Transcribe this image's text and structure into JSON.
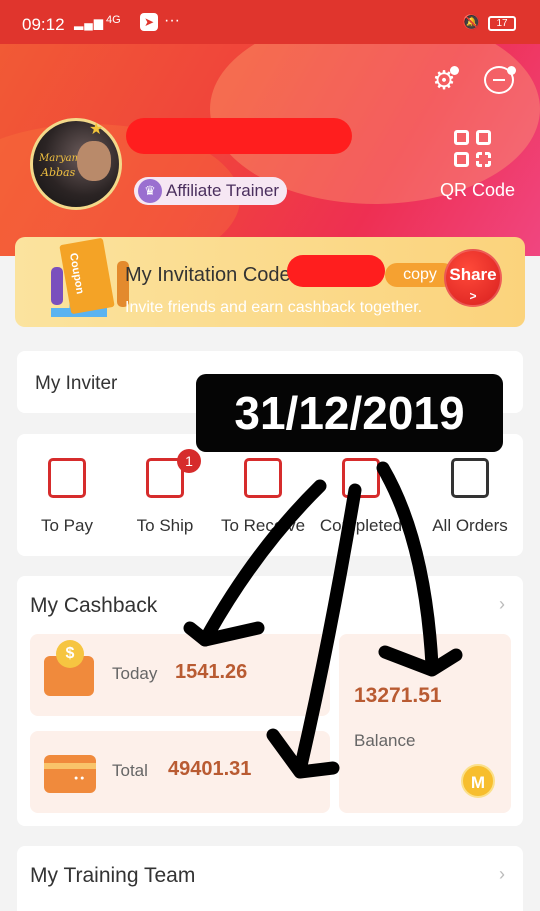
{
  "status_bar": {
    "time": "09:12",
    "network": "4G",
    "battery": "17"
  },
  "profile": {
    "role_badge": "Affiliate Trainer",
    "avatar_text_1": "Maryam",
    "avatar_text_2": "Abbas",
    "qr_label": "QR Code"
  },
  "invite": {
    "title": "My Invitation Code",
    "copy_label": "copy",
    "subtitle": "Invite friends and earn cashback together.",
    "share_label": "Share",
    "coupon_text": "Coupon"
  },
  "inviter": {
    "label": "My Inviter"
  },
  "overlay": {
    "date": "31/12/2019"
  },
  "orders": [
    {
      "label": "To Pay"
    },
    {
      "label": "To Ship",
      "badge": "1"
    },
    {
      "label": "To Receive"
    },
    {
      "label": "Completed"
    },
    {
      "label": "All Orders"
    }
  ],
  "cashback": {
    "title": "My Cashback",
    "today_label": "Today",
    "today_value": "1541.26",
    "total_label": "Total",
    "total_value": "49401.31",
    "balance_value": "13271.51",
    "balance_label": "Balance",
    "coin_letter": "M"
  },
  "training": {
    "title": "My Training Team"
  },
  "colors": {
    "brand_red": "#e0352d",
    "accent_orange": "#f5a131",
    "value_brown": "#b95b32"
  }
}
